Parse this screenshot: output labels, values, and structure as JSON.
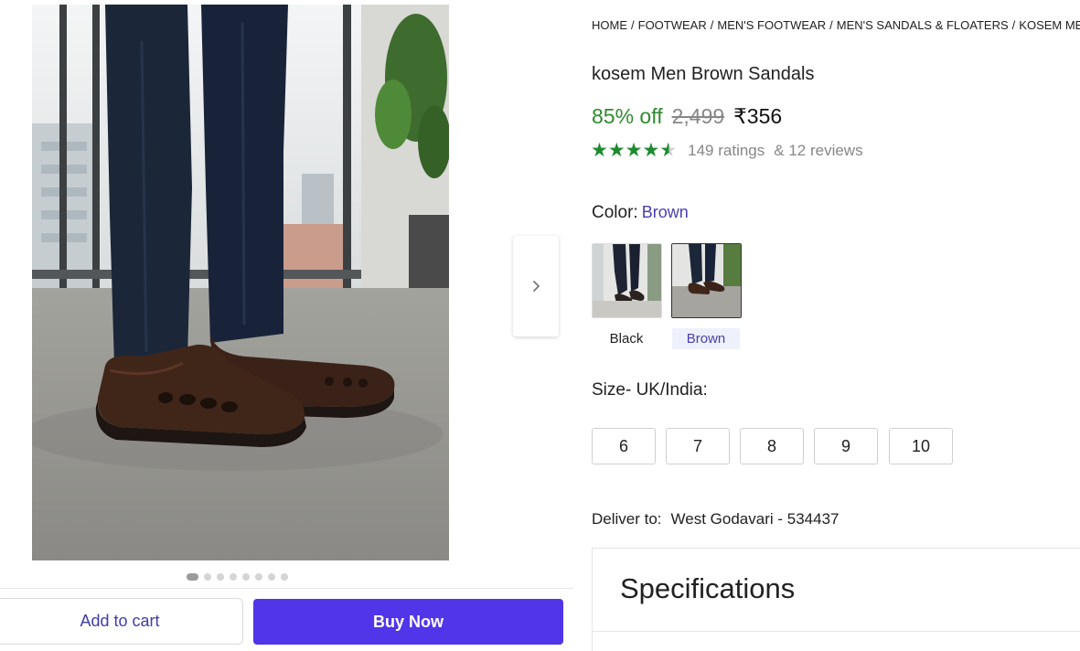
{
  "gallery": {
    "image_alt": "Man wearing brown leather sandals",
    "dot_count": 8,
    "active_dot": 0
  },
  "actions": {
    "add_to_cart": "Add to cart",
    "buy_now": "Buy Now"
  },
  "breadcrumb": [
    "HOME",
    "FOOTWEAR",
    "MEN'S FOOTWEAR",
    "MEN'S SANDALS & FLOATERS",
    "KOSEM MEN'S"
  ],
  "product": {
    "title": "kosem Men Brown Sandals",
    "discount": "85% off",
    "mrp": "2,499",
    "price": "₹356",
    "rating_value": 4.3,
    "ratings_text": "149 ratings",
    "reviews_text": "& 12 reviews"
  },
  "color": {
    "label": "Color:",
    "selected": "Brown",
    "options": [
      "Black",
      "Brown"
    ]
  },
  "size": {
    "label": "Size- UK/India:",
    "options": [
      "6",
      "7",
      "8",
      "9",
      "10"
    ]
  },
  "delivery": {
    "label": "Deliver to:",
    "location": "West Godavari - 534437"
  },
  "specifications": {
    "title": "Specifications"
  },
  "colors": {
    "accent": "#5135e8",
    "discount_green": "#2e8b2e",
    "star_green": "#1d8a2f",
    "link_purple": "#4a3fb0"
  }
}
